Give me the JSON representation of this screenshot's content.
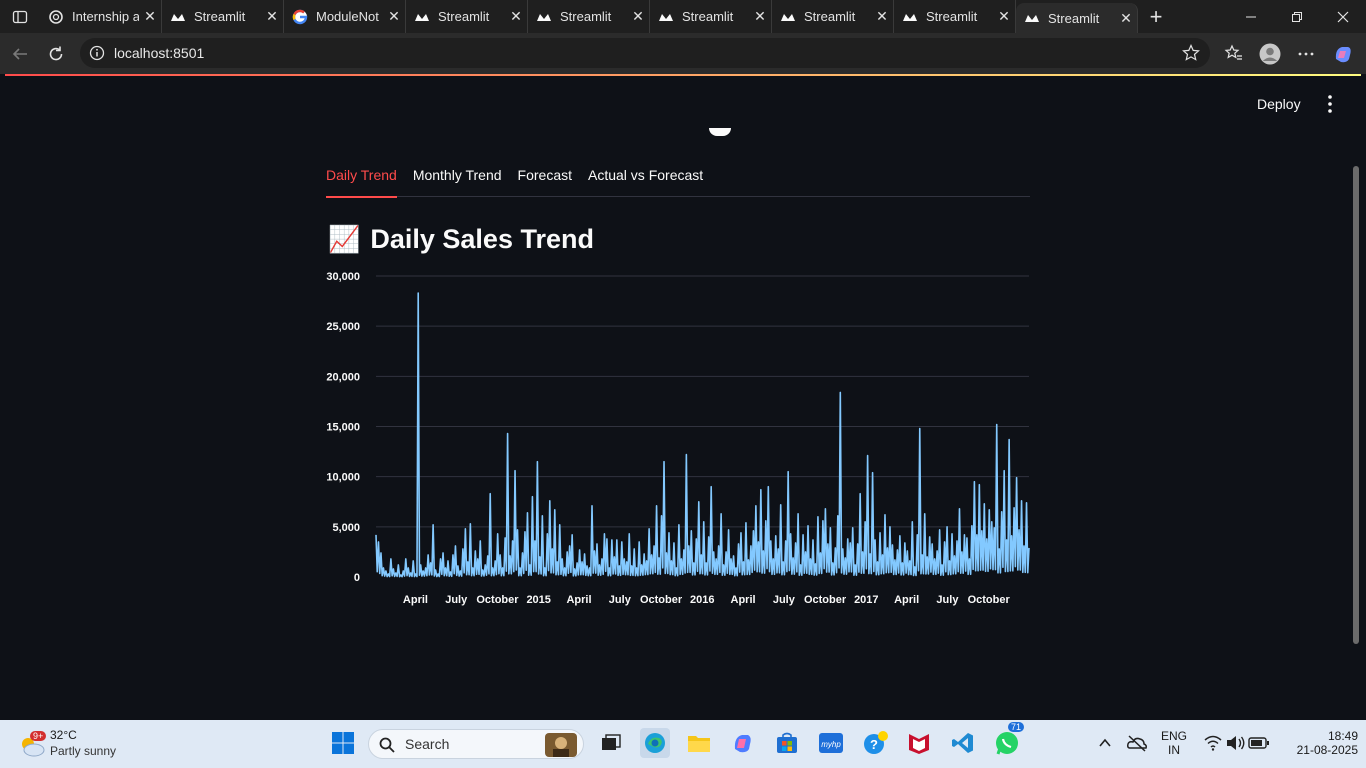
{
  "browser": {
    "tabs": [
      {
        "title": "Internship a",
        "icon": "chatgpt-icon"
      },
      {
        "title": "Streamlit",
        "icon": "streamlit-icon"
      },
      {
        "title": "ModuleNot",
        "icon": "google-icon"
      },
      {
        "title": "Streamlit",
        "icon": "streamlit-icon"
      },
      {
        "title": "Streamlit",
        "icon": "streamlit-icon"
      },
      {
        "title": "Streamlit",
        "icon": "streamlit-icon"
      },
      {
        "title": "Streamlit",
        "icon": "streamlit-icon"
      },
      {
        "title": "Streamlit",
        "icon": "streamlit-icon"
      },
      {
        "title": "Streamlit",
        "icon": "streamlit-icon",
        "active": true
      }
    ],
    "url": "localhost:8501"
  },
  "app": {
    "deploy_label": "Deploy",
    "tabs": [
      "Daily Trend",
      "Monthly Trend",
      "Forecast",
      "Actual vs Forecast"
    ],
    "active_tab": "Daily Trend",
    "heading_emoji": "📈",
    "heading": "Daily Sales Trend",
    "accent_color": "#ff4b4b",
    "series_color": "#83c9ff"
  },
  "chart_data": {
    "type": "line",
    "title": "",
    "xlabel": "",
    "ylabel": "",
    "ylim": [
      0,
      30000
    ],
    "y_ticks": [
      "30,000",
      "25,000",
      "20,000",
      "15,000",
      "10,000",
      "5,000",
      "0"
    ],
    "x_ticks": [
      "April",
      "July",
      "October",
      "2015",
      "April",
      "July",
      "October",
      "2016",
      "April",
      "July",
      "October",
      "2017",
      "April",
      "July",
      "October"
    ],
    "x_range": [
      "2014-01-03",
      "2017-12-30"
    ],
    "grid": true,
    "series": [
      {
        "values": [
          4200,
          3500,
          2400,
          900,
          600,
          300,
          1800,
          800,
          400,
          1200,
          200,
          600,
          1800,
          900,
          400,
          1600,
          300,
          28300,
          1200,
          600,
          900,
          2200,
          1400,
          5200,
          700,
          300,
          1800,
          2400,
          900,
          1600,
          500,
          2200,
          3100,
          1100,
          600,
          2800,
          4800,
          1500,
          5300,
          900,
          2600,
          1800,
          3600,
          700,
          1200,
          2100,
          8300,
          900,
          1600,
          4300,
          2200,
          900,
          3900,
          14300,
          2100,
          3600,
          10600,
          4700,
          900,
          2400,
          4500,
          6400,
          1200,
          8000,
          3600,
          11500,
          2000,
          6100,
          900,
          4300,
          7600,
          2800,
          6700,
          1500,
          5200,
          1800,
          900,
          2500,
          3100,
          4200,
          800,
          1400,
          2700,
          1500,
          2300,
          1100,
          900,
          7100,
          2600,
          3300,
          1200,
          1800,
          4300,
          3800,
          900,
          3700,
          2000,
          3700,
          1100,
          3500,
          1800,
          1500,
          4300,
          1100,
          2800,
          900,
          3500,
          1200,
          2300,
          1600,
          4800,
          2200,
          3100,
          7100,
          1900,
          6100,
          11500,
          2400,
          4400,
          1600,
          3400,
          900,
          5200,
          1800,
          2700,
          12200,
          3100,
          4600,
          1400,
          3800,
          7500,
          2200,
          5500,
          1400,
          4000,
          9000,
          2500,
          1800,
          3100,
          6300,
          1200,
          2500,
          4700,
          1800,
          2100,
          900,
          3300,
          4400,
          1500,
          5400,
          1700,
          3100,
          4600,
          7100,
          3500,
          8700,
          2600,
          5600,
          9000,
          3600,
          1800,
          4100,
          2800,
          7200,
          1500,
          3600,
          10500,
          4300,
          1900,
          3400,
          6300,
          1200,
          4200,
          2500,
          5100,
          1800,
          3700,
          1300,
          6000,
          2400,
          5600,
          6800,
          3300,
          4900,
          1400,
          2900,
          6100,
          18400,
          2800,
          1900,
          3800,
          3400,
          4900,
          1200,
          3300,
          8300,
          2500,
          5500,
          12100,
          2300,
          10400,
          3700,
          1500,
          4400,
          2200,
          6200,
          2900,
          5000,
          3200,
          1700,
          2700,
          4100,
          1400,
          3400,
          2600,
          1600,
          5500,
          1000,
          4200,
          14800,
          2200,
          6300,
          2000,
          4000,
          3300,
          1800,
          2600,
          4700,
          1200,
          3500,
          5000,
          1600,
          4300,
          2100,
          3600,
          6800,
          2500,
          4200,
          3900,
          1800,
          5100,
          9500,
          4200,
          9200,
          4600,
          7300,
          3800,
          6700,
          5500,
          4900,
          15200,
          2800,
          6500,
          10600,
          3700,
          13700,
          4100,
          6900,
          9900,
          4700,
          7600,
          3100,
          7400,
          2900
        ]
      }
    ]
  },
  "taskbar": {
    "weather_badge": "9+",
    "temperature": "32°C",
    "condition": "Partly sunny",
    "search_placeholder": "Search",
    "whatsapp_badge": "71",
    "language_line1": "ENG",
    "language_line2": "IN",
    "time": "18:49",
    "date": "21-08-2025"
  }
}
